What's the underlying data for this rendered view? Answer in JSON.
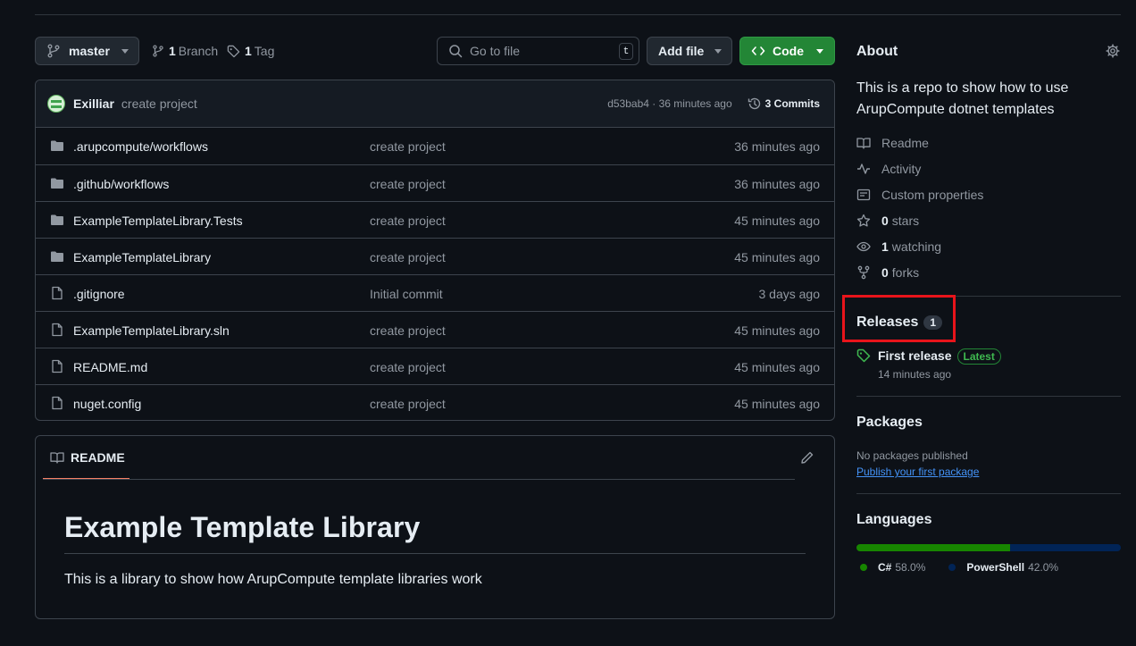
{
  "toolbar": {
    "branch": "master",
    "branch_count": "1",
    "branch_label": "Branch",
    "tag_count": "1",
    "tag_label": "Tag",
    "goto_placeholder": "Go to file",
    "goto_shortcut": "t",
    "add_file": "Add file",
    "code": "Code"
  },
  "commit": {
    "author": "Exilliar",
    "message": "create project",
    "hash_time": "d53bab4 · 36 minutes ago",
    "commits": "3 Commits"
  },
  "files": [
    {
      "type": "folder",
      "name": ".arupcompute/workflows",
      "message": "create project",
      "time": "36 minutes ago"
    },
    {
      "type": "folder",
      "name": ".github/workflows",
      "message": "create project",
      "time": "36 minutes ago"
    },
    {
      "type": "folder",
      "name": "ExampleTemplateLibrary.Tests",
      "message": "create project",
      "time": "45 minutes ago"
    },
    {
      "type": "folder",
      "name": "ExampleTemplateLibrary",
      "message": "create project",
      "time": "45 minutes ago"
    },
    {
      "type": "file",
      "name": ".gitignore",
      "message": "Initial commit",
      "time": "3 days ago"
    },
    {
      "type": "file",
      "name": "ExampleTemplateLibrary.sln",
      "message": "create project",
      "time": "45 minutes ago"
    },
    {
      "type": "file",
      "name": "README.md",
      "message": "create project",
      "time": "45 minutes ago"
    },
    {
      "type": "file",
      "name": "nuget.config",
      "message": "create project",
      "time": "45 minutes ago"
    }
  ],
  "readme": {
    "tab": "README",
    "heading": "Example Template Library",
    "body": "This is a library to show how ArupCompute template libraries work"
  },
  "about": {
    "title": "About",
    "description": "This is a repo to show how to use ArupCompute dotnet templates",
    "readme": "Readme",
    "activity": "Activity",
    "custom_properties": "Custom properties",
    "stars_count": "0",
    "stars_label": "stars",
    "watching_count": "1",
    "watching_label": "watching",
    "forks_count": "0",
    "forks_label": "forks"
  },
  "releases": {
    "title": "Releases",
    "count": "1",
    "name": "First release",
    "badge": "Latest",
    "time": "14 minutes ago"
  },
  "packages": {
    "title": "Packages",
    "none": "No packages published",
    "link": "Publish your first package"
  },
  "languages": {
    "title": "Languages",
    "items": [
      {
        "name": "C#",
        "percent": "58.0%",
        "value": 58.0,
        "color": "#178600"
      },
      {
        "name": "PowerShell",
        "percent": "42.0%",
        "value": 42.0,
        "color": "#012456"
      }
    ]
  },
  "colors": {
    "accent_green": "#238636",
    "highlight_red": "#e8141b",
    "link_blue": "#4493f8"
  }
}
